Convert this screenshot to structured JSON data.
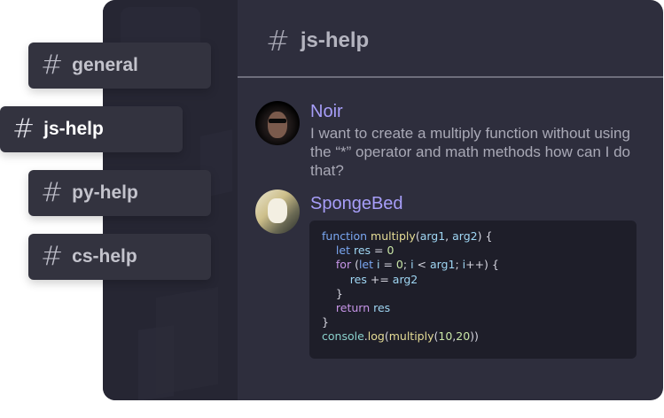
{
  "channels": [
    {
      "id": "general",
      "label": "general"
    },
    {
      "id": "js",
      "label": "js-help"
    },
    {
      "id": "py",
      "label": "py-help"
    },
    {
      "id": "cs",
      "label": "cs-help"
    }
  ],
  "active_channel": "js-help",
  "header": {
    "title": "js-help"
  },
  "messages": [
    {
      "author": "Noir",
      "text": "I want to create a multiply function without using the “*” operator and math methods how can I do that?"
    },
    {
      "author": "SpongeBed"
    }
  ],
  "code": {
    "lines": [
      "function multiply(arg1, arg2) {",
      "  let res = 0",
      "  for (let i = 0; i < arg1; i++) {",
      "      res += arg2",
      "  }",
      "  return res",
      "}",
      "console.log(multiply(10,20))"
    ]
  },
  "colors": {
    "accent": "#a79ef9",
    "background": "#2e2e3d",
    "sidebar": "#262633",
    "code_bg": "#1e1e29"
  }
}
